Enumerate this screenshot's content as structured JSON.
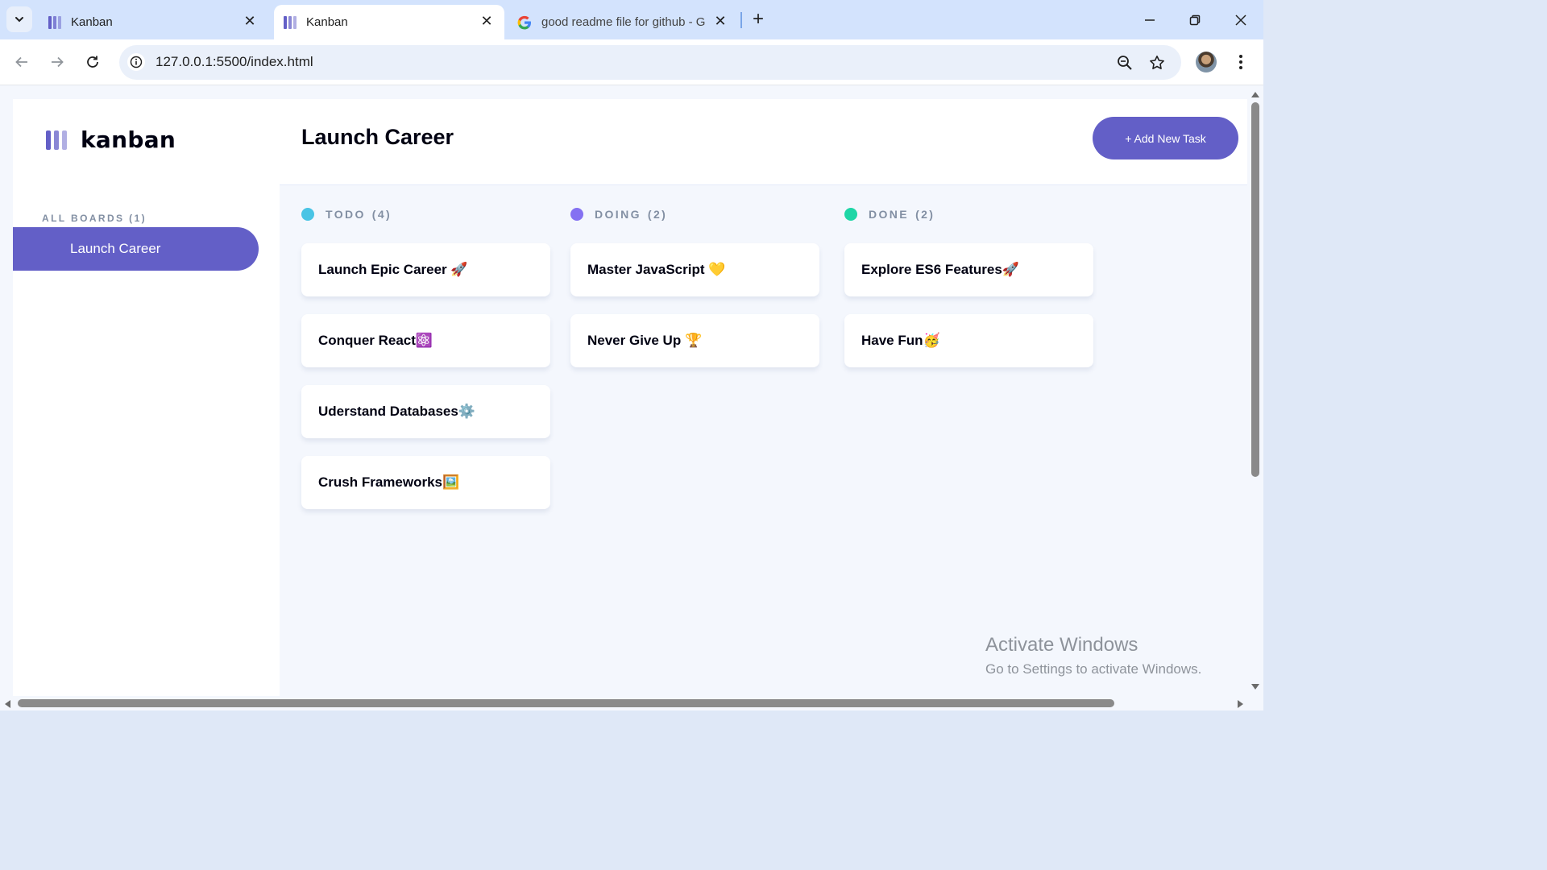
{
  "browser": {
    "tabs": [
      {
        "title": "Kanban",
        "icon": "kanban-favicon"
      },
      {
        "title": "Kanban",
        "icon": "kanban-favicon",
        "active": true
      },
      {
        "title": "good readme file for github - G",
        "icon": "google-icon"
      }
    ],
    "new_tab_symbol": "+",
    "url": "127.0.0.1:5500/index.html"
  },
  "app": {
    "logo_text": "kanban",
    "boards_title": "ALL BOARDS (1)",
    "boards": [
      {
        "name": "Launch Career"
      }
    ],
    "board_title": "Launch Career",
    "add_task_label": "+ Add New Task",
    "columns": [
      {
        "name": "TODO",
        "count": "(4)",
        "color": "#49C4E5",
        "tasks": [
          "Launch Epic Career 🚀",
          "Conquer React⚛️",
          "Uderstand Databases⚙️",
          "Crush Frameworks🖼️"
        ]
      },
      {
        "name": "DOING",
        "count": "(2)",
        "color": "#8471F2",
        "tasks": [
          "Master JavaScript 💛",
          "Never Give Up 🏆"
        ]
      },
      {
        "name": "DONE",
        "count": "(2)",
        "color": "#67E2AE",
        "tasks": [
          "Explore ES6 Features🚀",
          "Have Fun🥳"
        ]
      }
    ]
  },
  "watermark": {
    "line1": "Activate Windows",
    "line2": "Go to Settings to activate Windows."
  },
  "colors": {
    "accent": "#635FC7",
    "tabstrip": "#D3E3FD",
    "background": "#F4F7FD"
  }
}
